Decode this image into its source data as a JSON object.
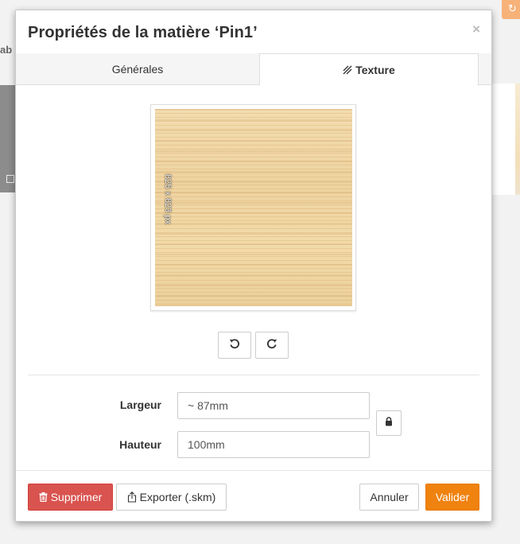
{
  "background": {
    "left_text": "ab",
    "orange_icon": "refresh-icon"
  },
  "dialog": {
    "title": "Propriétés de la matière ‘Pin1’",
    "close_label": "×",
    "tabs": [
      {
        "label": "Générales",
        "active": false
      },
      {
        "label": "Texture",
        "active": true,
        "icon": "hatch-icon"
      }
    ],
    "texture": {
      "dimensions_label": "825 x 823 px",
      "rotate_left_icon": "rotate-left-icon",
      "rotate_right_icon": "rotate-right-icon"
    },
    "fields": {
      "width_label": "Largeur",
      "width_value": "~ 87mm",
      "height_label": "Hauteur",
      "height_value": "100mm",
      "lock_icon": "lock-icon"
    },
    "footer": {
      "delete_label": "Supprimer",
      "export_label": "Exporter (.skm)",
      "cancel_label": "Annuler",
      "validate_label": "Valider"
    }
  },
  "colors": {
    "accent": "#f0820f",
    "danger": "#d9534f"
  }
}
